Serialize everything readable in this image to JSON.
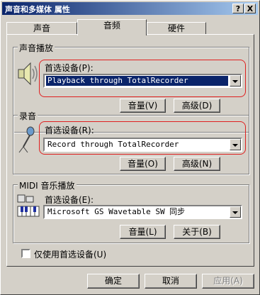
{
  "window": {
    "title": "声音和多媒体 属性",
    "help_glyph": "?",
    "close_glyph": "X"
  },
  "tabs": [
    {
      "label": "声音"
    },
    {
      "label": "音频"
    },
    {
      "label": "硬件"
    }
  ],
  "playback": {
    "legend": "声音播放",
    "device_label": "首选设备(P):",
    "device_value": "Playback through TotalRecorder",
    "volume_button": "音量(V)",
    "advanced_button": "高级(D)",
    "icon": "speaker-icon"
  },
  "recording": {
    "legend": "录音",
    "device_label": "首选设备(R):",
    "device_value": "Record through TotalRecorder",
    "volume_button": "音量(O)",
    "advanced_button": "高级(N)",
    "icon": "microphone-icon"
  },
  "midi": {
    "legend": "MIDI 音乐播放",
    "device_label": "首选设备(E):",
    "device_value": "Microsoft GS Wavetable SW 同步",
    "volume_button": "音量(L)",
    "about_button": "关于(B)",
    "icon": "midi-keyboard-icon"
  },
  "preferred_only": {
    "label": "仅使用首选设备(U)",
    "checked": false
  },
  "footer": {
    "ok": "确定",
    "cancel": "取消",
    "apply": "应用(A)"
  },
  "colors": {
    "face": "#d4d0c8",
    "title_start": "#0a246a",
    "title_end": "#a6caf0",
    "highlight_outline": "#e02020"
  }
}
